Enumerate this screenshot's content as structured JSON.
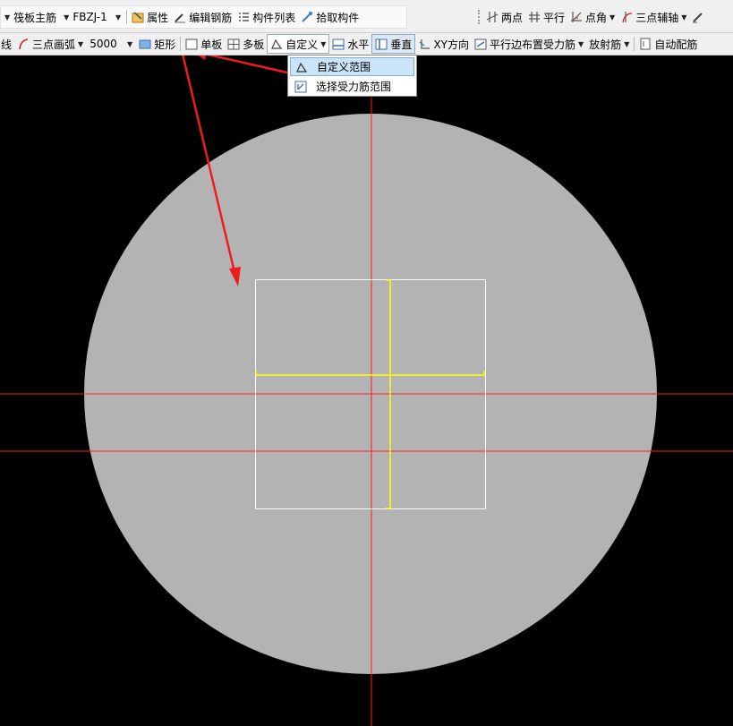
{
  "toolbar1": {
    "left_items": [
      {
        "name": "member-type-combo",
        "text": "筏板主筋"
      },
      {
        "name": "member-name-combo",
        "text": "FBZJ-1"
      },
      {
        "name": "properties-button",
        "text": "属性"
      },
      {
        "name": "edit-rebar-button",
        "text": "编辑钢筋"
      },
      {
        "name": "member-list-button",
        "text": "构件列表"
      },
      {
        "name": "pick-member-button",
        "text": "拾取构件"
      }
    ],
    "right_items": [
      {
        "name": "two-point-button",
        "text": "两点"
      },
      {
        "name": "parallel-button",
        "text": "平行"
      },
      {
        "name": "point-angle-button",
        "text": "点角"
      },
      {
        "name": "three-point-axis-button",
        "text": "三点辅轴"
      }
    ]
  },
  "toolbar2": {
    "line_label": "线",
    "arc_label": "三点画弧",
    "length_value": "5000",
    "rect_label": "矩形",
    "single_board_label": "单板",
    "multi_board_label": "多板",
    "custom_label": "自定义",
    "horizontal_label": "水平",
    "vertical_label": "垂直",
    "xy_label": "XY方向",
    "parallel_edge_label": "平行边布置受力筋",
    "radial_label": "放射筋",
    "auto_rebar_label": "自动配筋"
  },
  "menu": {
    "items": [
      {
        "label": "自定义范围",
        "highlighted": true
      },
      {
        "label": "选择受力筋范围",
        "highlighted": false
      }
    ]
  },
  "colors": {
    "canvas_bg": "#000000",
    "circle": "#b3b3b3",
    "axis": "#ff1e1e",
    "rect": "#ffffff",
    "rebar": "#ffff00",
    "annotation_arrow": "#ee1c1c"
  }
}
